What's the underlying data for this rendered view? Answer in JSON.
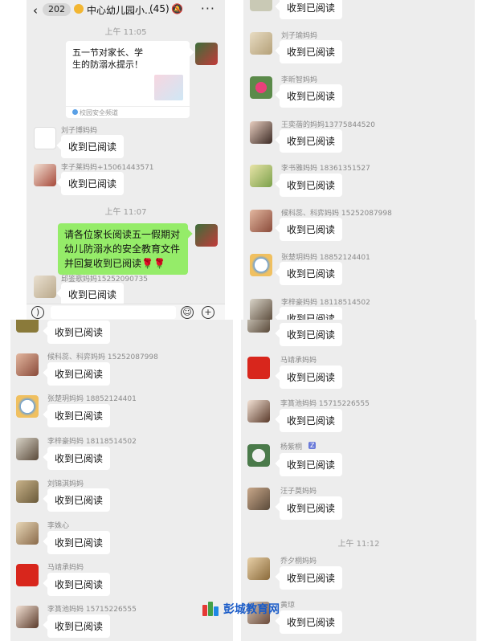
{
  "header": {
    "back": "‹",
    "unread_count": "202",
    "title": "中心幼儿园小...",
    "member_count": "(45)",
    "more": "···"
  },
  "message_read_text": "收到已阅读",
  "panel1": {
    "time1": "上午 11:05",
    "card": {
      "title": "五一节对家长、学生的防溺水提示！",
      "source": "校园安全频道"
    },
    "msgs": [
      {
        "nick": "刘子博妈妈"
      },
      {
        "nick": "李子莱妈妈+15061443571"
      }
    ],
    "time2": "上午 11:07",
    "notice": "请各位家长阅读五一假期对幼儿防溺水的安全教育文件并回复收到已阅读🌹🌹",
    "last_nick": "邱鉴歌妈妈15252090735"
  },
  "panel2": {
    "msgs": [
      {
        "nick": "刘子瑜妈妈"
      },
      {
        "nick": "李昕智妈妈"
      },
      {
        "nick": "王奕蓓的妈妈13775844520"
      },
      {
        "nick": "李书雅妈妈 18361351527"
      },
      {
        "nick": "候科蕊、科弈妈妈 15252087998"
      },
      {
        "nick": "张楚玥妈妈 18852124401"
      },
      {
        "nick": "李梓豪妈妈 18118514502"
      }
    ]
  },
  "panel3": {
    "msgs": [
      {
        "nick": "候科蕊、科弈妈妈 15252087998"
      },
      {
        "nick": "张楚玥妈妈 18852124401"
      },
      {
        "nick": "李梓豪妈妈 18118514502"
      },
      {
        "nick": "刘锦淇妈妈"
      },
      {
        "nick": "李姝心"
      },
      {
        "nick": "马靖承妈妈"
      },
      {
        "nick": "李篔池妈妈 15715226555"
      }
    ]
  },
  "panel4": {
    "msgs": [
      {
        "nick": "马靖承妈妈"
      },
      {
        "nick": "李篔池妈妈 15715226555"
      },
      {
        "nick": "杨紫桐",
        "badge": "Z"
      },
      {
        "nick": "汪子莫妈妈"
      }
    ],
    "time": "上午 11:12",
    "msgs2": [
      {
        "nick": "乔夕桐妈妈"
      },
      {
        "nick": "黄琼"
      }
    ]
  },
  "watermark": {
    "text": "彭城教育网"
  },
  "colors": {
    "chat_bg": "#ededed",
    "bubble_green": "#95ec69",
    "nick_gray": "#8a8a8a",
    "watermark_blue": "#1b5cc8"
  }
}
